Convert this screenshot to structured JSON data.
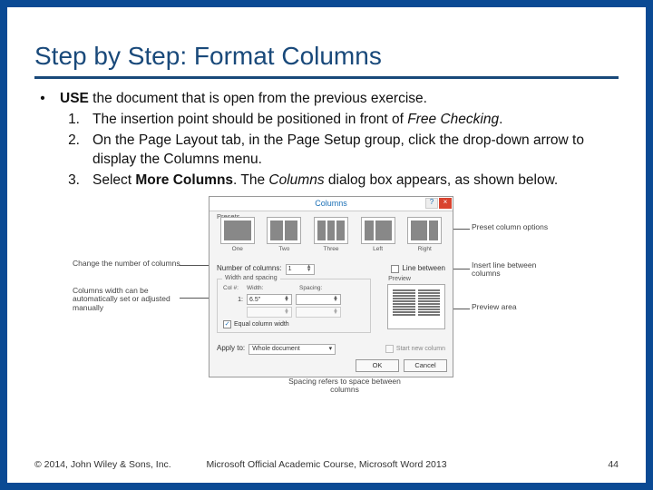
{
  "title": "Step by Step: Format Columns",
  "lead_bold": "USE",
  "lead_rest": " the document that is open from the previous exercise.",
  "steps": [
    {
      "num": "1.",
      "pre": "The insertion point should be positioned in front of ",
      "ital": "Free Checking",
      "post": "."
    },
    {
      "num": "2.",
      "pre": "On the Page Layout tab, in the Page Setup group, click the drop-down arrow to display the Columns menu.",
      "ital": "",
      "post": ""
    },
    {
      "num": "3.",
      "pre": "Select ",
      "bold": "More Columns",
      "mid": ". The ",
      "ital": "Columns",
      "post": " dialog box appears, as shown below."
    }
  ],
  "footer": {
    "left": "© 2014, John Wiley & Sons, Inc.",
    "center": "Microsoft Official Academic Course, Microsoft Word 2013",
    "page": "44"
  },
  "dialog": {
    "title": "Columns",
    "help": "?",
    "close": "×",
    "presets_label": "Presets",
    "presets": [
      "One",
      "Two",
      "Three",
      "Left",
      "Right"
    ],
    "numcols_label": "Number of columns:",
    "numcols_value": "1",
    "line_between": "Line between",
    "ws_title": "Width and spacing",
    "ws_headers": [
      "Col #:",
      "Width:",
      "Spacing:"
    ],
    "ws_row1": {
      "col": "1:",
      "width": "6.5\"",
      "spacing": ""
    },
    "equal_label": "Equal column width",
    "preview_label": "Preview",
    "apply_label": "Apply to:",
    "apply_value": "Whole document",
    "start_new": "Start new column",
    "ok": "OK",
    "cancel": "Cancel"
  },
  "callouts": {
    "left1": "Change the number of columns",
    "left2": "Columns width can be automatically set or adjusted manually",
    "right1": "Preset column options",
    "right2": "Insert line between columns",
    "right3": "Preview area",
    "bottom": "Spacing refers to space between columns"
  }
}
